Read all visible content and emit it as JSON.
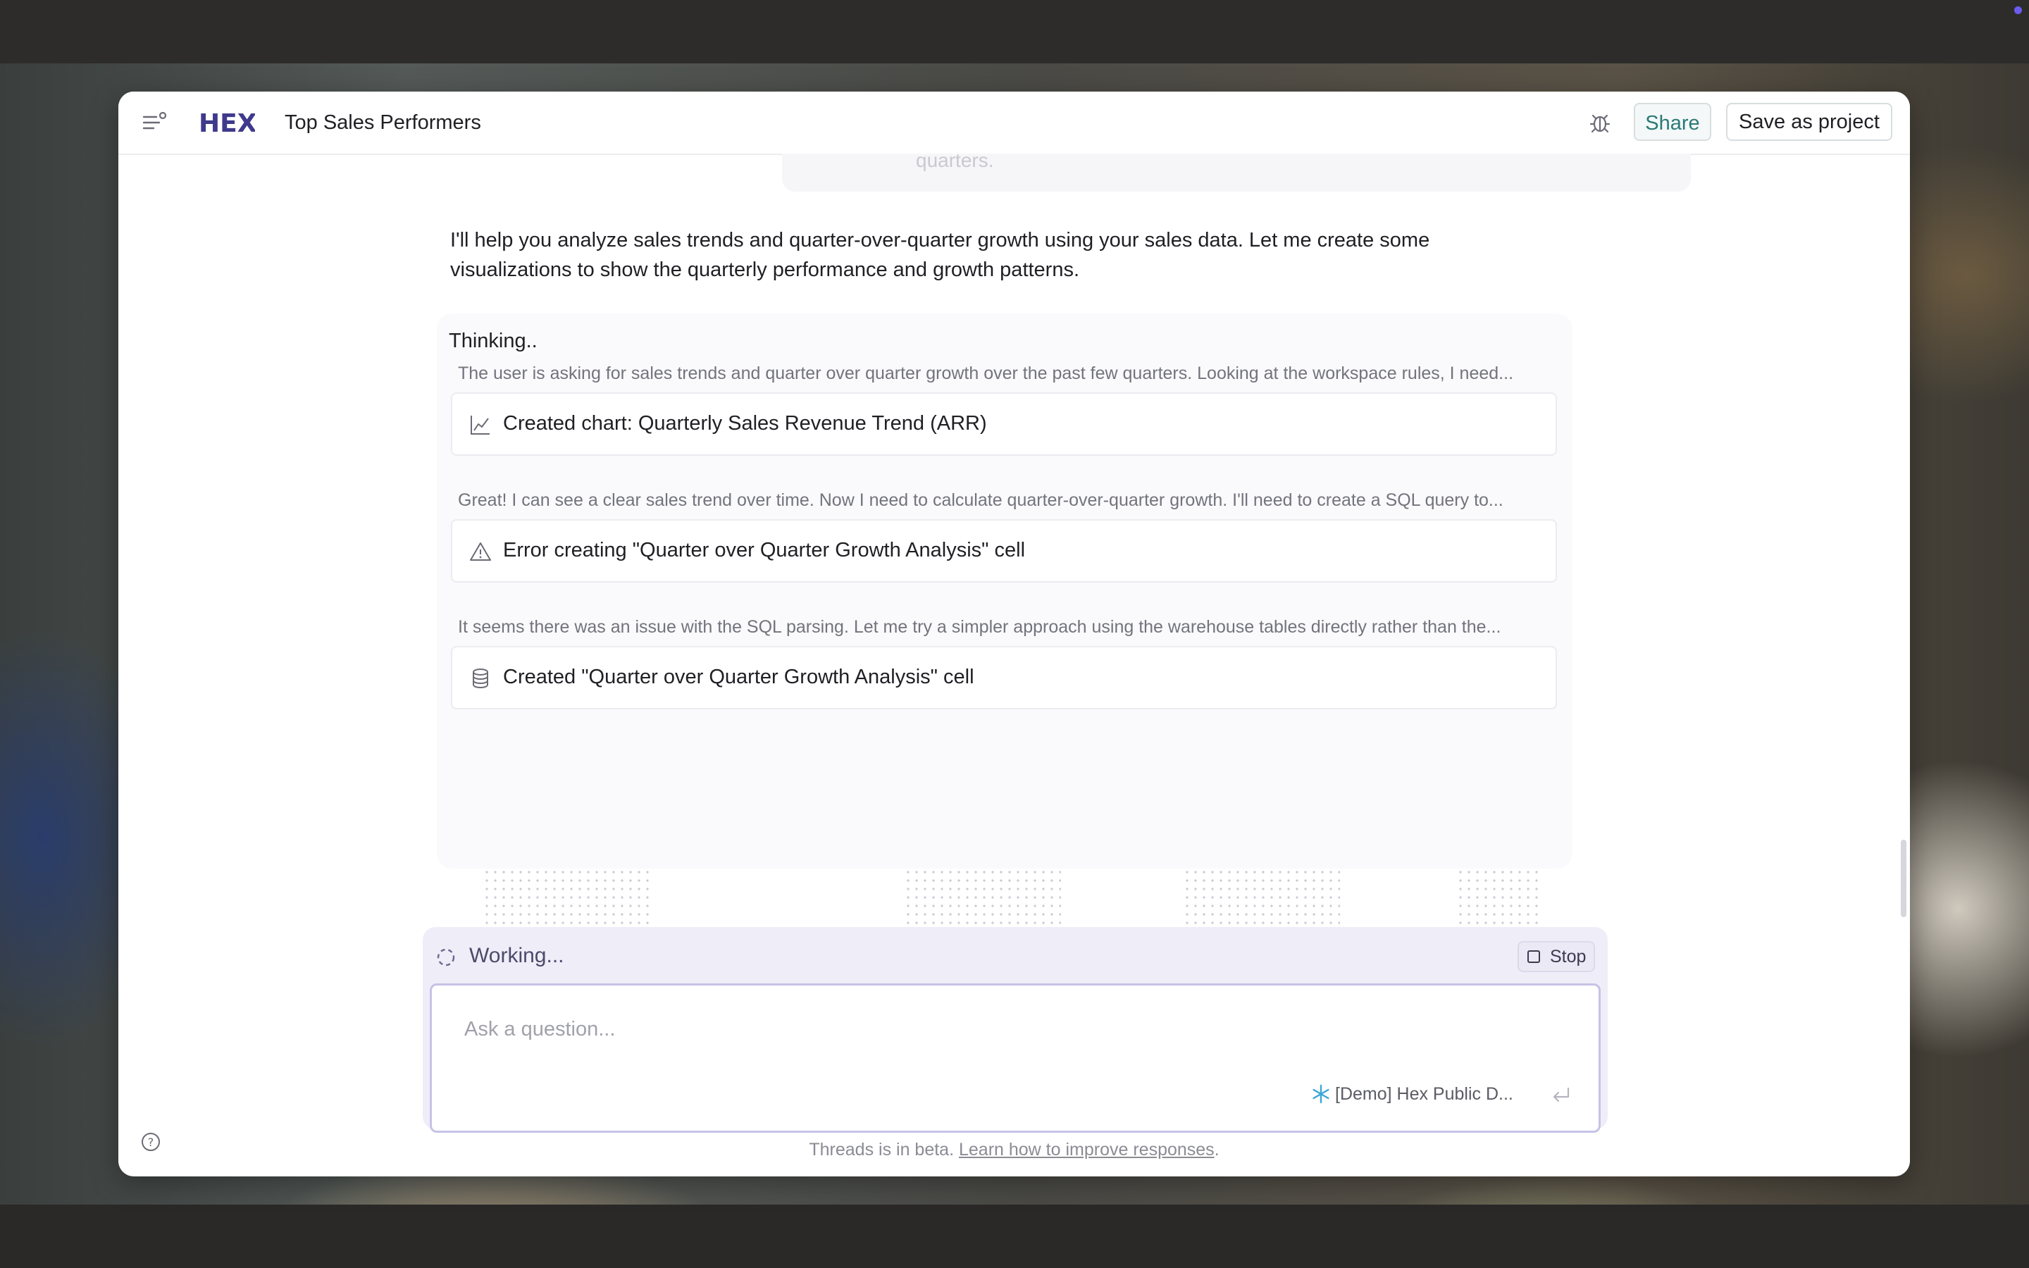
{
  "header": {
    "logo": "HEX",
    "title": "Top Sales Performers",
    "share_label": "Share",
    "save_label": "Save as project"
  },
  "previous_message_tail": "quarters.",
  "assistant": {
    "intro": "I'll help you analyze sales trends and quarter-over-quarter growth using your sales data. Let me create some visualizations to show the quarterly performance and growth patterns.",
    "thinking_title": "Thinking..",
    "thoughts": [
      "The user is asking for sales trends and quarter over quarter growth over the past few quarters. Looking at the workspace rules, I need...",
      "Great! I can see a clear sales trend over time. Now I need to calculate quarter-over-quarter growth. I'll need to create a SQL query to...",
      "It seems there was an issue with the SQL parsing. Let me try a simpler approach using the warehouse tables directly rather than the..."
    ],
    "steps": [
      {
        "icon": "line-chart-icon",
        "label": "Created chart: Quarterly Sales Revenue Trend (ARR)"
      },
      {
        "icon": "warning-icon",
        "label": "Error creating \"Quarter over Quarter Growth Analysis\" cell"
      },
      {
        "icon": "database-icon",
        "label": "Created \"Quarter over Quarter Growth Analysis\" cell"
      }
    ]
  },
  "composer": {
    "status": "Working...",
    "stop_label": "Stop",
    "placeholder": "Ask a question...",
    "data_source": "[Demo] Hex Public D..."
  },
  "footer": {
    "note": "Threads is in beta.",
    "link": "Learn how to improve responses",
    "period": "."
  },
  "colors": {
    "brand": "#3f3a8c",
    "share_text": "#2a7a78",
    "composer_bg": "#efedf8",
    "input_border": "#c6c2e6"
  }
}
